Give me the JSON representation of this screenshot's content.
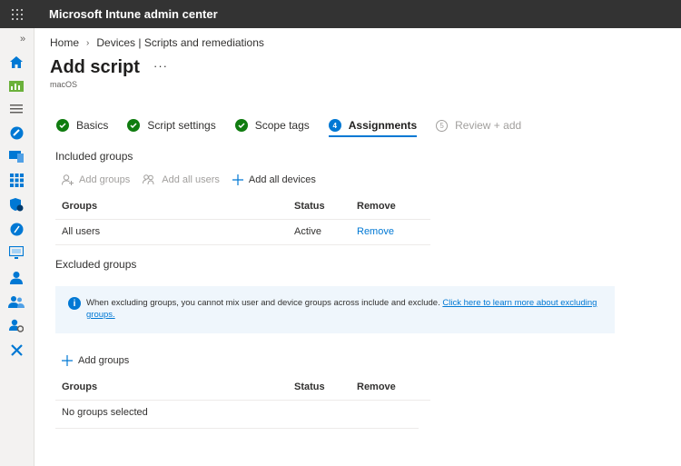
{
  "header": {
    "app_title": "Microsoft Intune admin center"
  },
  "nav": {
    "expand_glyph": "»",
    "items": [
      "home-icon",
      "dashboard-icon",
      "all-services-icon",
      "devices-icon",
      "apps-icon",
      "endpoint-security-icon",
      "reports-icon",
      "users-icon",
      "groups-icon",
      "tenant-admin-icon",
      "troubleshooting-icon"
    ]
  },
  "breadcrumb": {
    "home": "Home",
    "sep": "›",
    "current": "Devices | Scripts and remediations"
  },
  "page": {
    "title": "Add script",
    "more": "···",
    "subtitle": "macOS"
  },
  "wizard": {
    "steps": [
      {
        "label": "Basics",
        "state": "done"
      },
      {
        "label": "Script settings",
        "state": "done"
      },
      {
        "label": "Scope tags",
        "state": "done"
      },
      {
        "label": "Assignments",
        "state": "current",
        "number": "4"
      },
      {
        "label": "Review + add",
        "state": "todo",
        "number": "5"
      }
    ]
  },
  "included": {
    "heading": "Included groups",
    "commands": {
      "add_groups": "Add groups",
      "add_all_users": "Add all users",
      "add_all_devices": "Add all devices"
    },
    "columns": {
      "groups": "Groups",
      "status": "Status",
      "remove": "Remove"
    },
    "rows": [
      {
        "group": "All users",
        "status": "Active",
        "remove": "Remove"
      }
    ]
  },
  "excluded": {
    "heading": "Excluded groups",
    "info_text": "When excluding groups, you cannot mix user and device groups across include and exclude. ",
    "info_link": "Click here to learn more about excluding groups.",
    "add_groups": "Add groups",
    "columns": {
      "groups": "Groups",
      "status": "Status",
      "remove": "Remove"
    },
    "empty_text": "No groups selected"
  },
  "colors": {
    "accent": "#0078d4",
    "success": "#107c10",
    "topbar": "#333333"
  }
}
